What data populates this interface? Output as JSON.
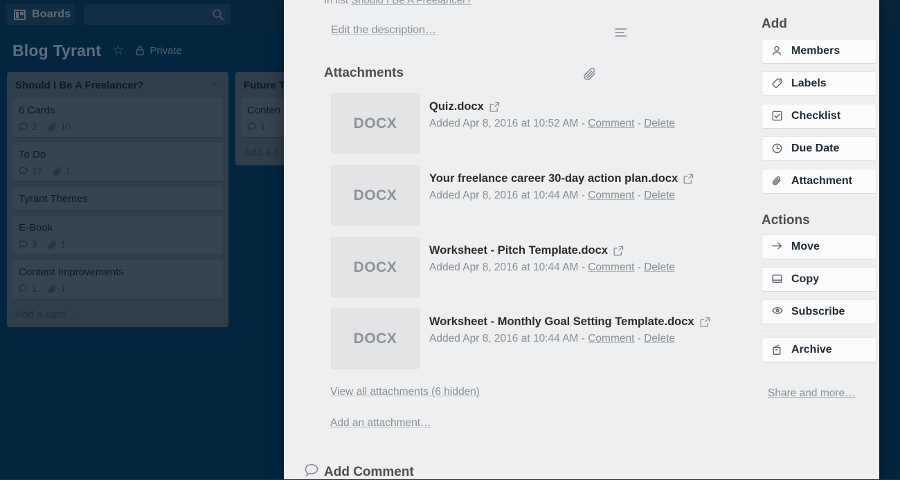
{
  "topbar": {
    "boards_label": "Boards",
    "boards_icon": "boards-grid-icon",
    "search_placeholder": "",
    "search_value": "",
    "search_icon": "search-icon"
  },
  "board_header": {
    "title": "Blog Tyrant",
    "star_icon": "star-icon",
    "lock_icon": "lock-icon",
    "privacy_label": "Private"
  },
  "lists": [
    {
      "title": "Should I Be A Freelancer?",
      "menu_icon": "list-menu-ellipsis-icon",
      "add_card_label": "Add a card…",
      "cards": [
        {
          "title": "6 Cards",
          "comments": "2",
          "attachments": "10"
        },
        {
          "title": "To Do",
          "comments": "17",
          "attachments": "1"
        },
        {
          "title": "Tyrant Themes",
          "comments": "",
          "attachments": ""
        },
        {
          "title": "E-Book",
          "comments": "3",
          "attachments": "1"
        },
        {
          "title": "Content Improvements",
          "comments": "1",
          "attachments": "1"
        }
      ]
    },
    {
      "title": "Future T",
      "add_card_label": "Add a c",
      "cards": [
        {
          "title": "Conten",
          "comments": "1",
          "attachments": ""
        }
      ]
    }
  ],
  "modal": {
    "in_list_prefix": "In list ",
    "in_list_link": "Should I Be A Freelancer?",
    "description_icon": "description-lines-icon",
    "edit_description_label": "Edit the description…",
    "attachments_icon": "paperclip-icon",
    "attachments_title": "Attachments",
    "attachments": [
      {
        "thumb_label": "DOCX",
        "name": "Quiz.docx",
        "open_icon": "external-link-icon",
        "added": "Added Apr 8, 2016 at 10:52 AM",
        "separator": " - ",
        "comment_label": "Comment",
        "delete_label": "Delete"
      },
      {
        "thumb_label": "DOCX",
        "name": "Your freelance career 30-day action plan.docx",
        "open_icon": "external-link-icon",
        "added": "Added Apr 8, 2016 at 10:44 AM",
        "separator": " - ",
        "comment_label": "Comment",
        "delete_label": "Delete"
      },
      {
        "thumb_label": "DOCX",
        "name": "Worksheet - Pitch Template.docx",
        "open_icon": "external-link-icon",
        "added": "Added Apr 8, 2016 at 10:44 AM",
        "separator": " - ",
        "comment_label": "Comment",
        "delete_label": "Delete"
      },
      {
        "thumb_label": "DOCX",
        "name": "Worksheet - Monthly Goal Setting Template.docx",
        "open_icon": "external-link-icon",
        "added": "Added Apr 8, 2016 at 10:44 AM",
        "separator": " - ",
        "comment_label": "Comment",
        "delete_label": "Delete"
      }
    ],
    "view_all_label": "View all attachments (6 hidden)",
    "add_attachment_label": "Add an attachment…",
    "comment_icon": "comment-bubble-icon",
    "add_comment_title": "Add Comment"
  },
  "sidebar": {
    "add_heading": "Add",
    "add_items": [
      {
        "label": "Members",
        "icon": "person-icon"
      },
      {
        "label": "Labels",
        "icon": "tag-icon"
      },
      {
        "label": "Checklist",
        "icon": "checkbox-icon"
      },
      {
        "label": "Due Date",
        "icon": "clock-icon"
      },
      {
        "label": "Attachment",
        "icon": "paperclip-icon"
      }
    ],
    "actions_heading": "Actions",
    "action_items": [
      {
        "label": "Move",
        "icon": "arrow-right-icon"
      },
      {
        "label": "Copy",
        "icon": "copy-icon"
      },
      {
        "label": "Subscribe",
        "icon": "eye-icon"
      },
      {
        "label": "Archive",
        "icon": "archive-box-icon"
      }
    ],
    "share_label": "Share and more…"
  },
  "colors": {
    "board_bg": "#023a5e",
    "topbar_bg": "#0b3a5b",
    "list_bg": "#5c6a74",
    "card_bg": "#6b7780",
    "modal_bg": "#edeff0",
    "thumb_bg": "#e2e4e6",
    "muted_text": "#8a8e92",
    "dark_text": "#1c2b36"
  }
}
